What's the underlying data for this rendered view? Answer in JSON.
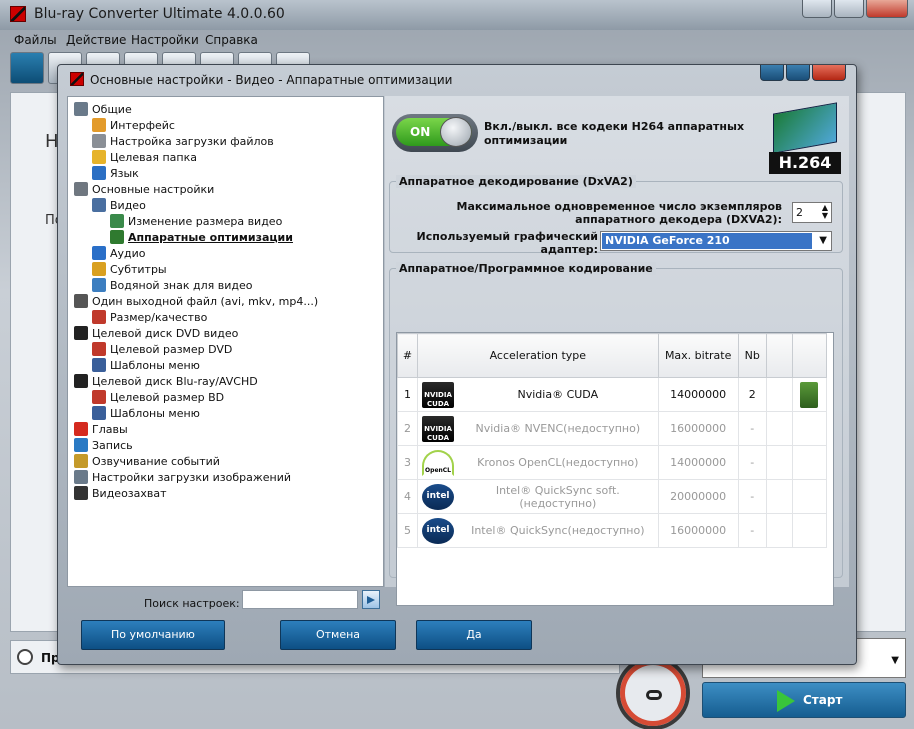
{
  "main_window": {
    "title": "Blu-ray Converter Ultimate 4.0.0.60",
    "menu": [
      "Файлы",
      "Действие",
      "Настройки",
      "Справка"
    ],
    "panel_label_1": "Н",
    "panel_label_2": "По",
    "bottom_left_text": "Пр",
    "profile_value": ")",
    "start_label": "Старт"
  },
  "dialog": {
    "title": "Основные настройки - Видео - Аппаратные оптимизации",
    "tree": [
      {
        "label": "Общие",
        "level": 0,
        "icon": "tools-icon",
        "color": "#6a7a8a"
      },
      {
        "label": "Интерфейс",
        "level": 1,
        "icon": "palette-icon",
        "color": "#e39b2b"
      },
      {
        "label": "Настройка загрузки файлов",
        "level": 1,
        "icon": "document-icon",
        "color": "#8a8f96"
      },
      {
        "label": "Целевая папка",
        "level": 1,
        "icon": "folder-icon",
        "color": "#e6b32a"
      },
      {
        "label": "Язык",
        "level": 1,
        "icon": "globe-icon",
        "color": "#2b6fc4"
      },
      {
        "label": "Основные настройки",
        "level": 0,
        "icon": "gear-icon",
        "color": "#6f7780"
      },
      {
        "label": "Видео",
        "level": 1,
        "icon": "video-icon",
        "color": "#4a6fa0"
      },
      {
        "label": "Изменение размера видео",
        "level": 2,
        "icon": "resize-icon",
        "color": "#3a8a4a"
      },
      {
        "label": "Аппаратные оптимизации",
        "level": 2,
        "icon": "gpu-icon",
        "color": "#2f7a2f",
        "selected": true
      },
      {
        "label": "Аудио",
        "level": 1,
        "icon": "music-note-icon",
        "color": "#2a6fc8"
      },
      {
        "label": "Субтитры",
        "level": 1,
        "icon": "subtitle-icon",
        "color": "#d9a020"
      },
      {
        "label": "Водяной знак для видео",
        "level": 1,
        "icon": "image-icon",
        "color": "#3c7ec0"
      },
      {
        "label": "Один выходной файл (avi, mkv, mp4...)",
        "level": 0,
        "icon": "merge-icon",
        "color": "#555"
      },
      {
        "label": "Размер/качество",
        "level": 1,
        "icon": "quality-icon",
        "color": "#c0392b"
      },
      {
        "label": "Целевой диск DVD видео",
        "level": 0,
        "icon": "dvd-icon",
        "color": "#222"
      },
      {
        "label": "Целевой размер DVD",
        "level": 1,
        "icon": "disc-size-icon",
        "color": "#c0392b"
      },
      {
        "label": "Шаблоны меню",
        "level": 1,
        "icon": "menu-template-icon",
        "color": "#3a5f9a"
      },
      {
        "label": "Целевой диск Blu-ray/AVCHD",
        "level": 0,
        "icon": "hd-icon",
        "color": "#222"
      },
      {
        "label": "Целевой размер BD",
        "level": 1,
        "icon": "disc-size-icon",
        "color": "#c0392b"
      },
      {
        "label": "Шаблоны меню",
        "level": 1,
        "icon": "menu-template-icon",
        "color": "#3a5f9a"
      },
      {
        "label": "Главы",
        "level": 0,
        "icon": "flag-icon",
        "color": "#d42a1f"
      },
      {
        "label": "Запись",
        "level": 0,
        "icon": "burn-disc-icon",
        "color": "#2a7ac4"
      },
      {
        "label": "Озвучивание событий",
        "level": 0,
        "icon": "sound-icon",
        "color": "#c49a2a"
      },
      {
        "label": "Настройки загрузки изображений",
        "level": 0,
        "icon": "image-settings-icon",
        "color": "#6a7a8a"
      },
      {
        "label": "Видеозахват",
        "level": 0,
        "icon": "camera-icon",
        "color": "#333"
      }
    ],
    "search_label": "Поиск настроек:",
    "search_value": "",
    "buttons": {
      "default": "По умолчанию",
      "cancel": "Отмена",
      "ok": "Да"
    },
    "toggle_label": "ON",
    "toggle_state": "on",
    "h264_text": "Вкл./выкл. все кодеки H264 аппаратных оптимизации",
    "h264_logo": "H.264",
    "decode_group": "Аппаратное декодирование (DxVA2)",
    "max_instances_label": "Максимальное одновременное число экземпляров аппаратного декодера (DXVA2):",
    "max_instances_value": "2",
    "adapter_label": "Используемый графический адаптер:",
    "adapter_value": "NVIDIA GeForce 210",
    "encode_group": "Аппаратное/Программное кодирование",
    "table": {
      "headers": [
        "#",
        "Acceleration type",
        "Max. bitrate",
        "Nb",
        "",
        ""
      ],
      "rows": [
        {
          "num": "1",
          "badge": "nvidia-cuda-logo",
          "badge_text": "NVIDIA CUDA",
          "type": "Nvidia® CUDA",
          "bitrate": "14000000",
          "nb": "2",
          "enabled": true
        },
        {
          "num": "2",
          "badge": "nvidia-cuda-logo",
          "badge_text": "NVIDIA CUDA",
          "type": "Nvidia® NVENC(недоступно)",
          "bitrate": "16000000",
          "nb": "-",
          "enabled": false
        },
        {
          "num": "3",
          "badge": "opencl-logo",
          "badge_text": "OpenCL",
          "type": "Kronos OpenCL(недоступно)",
          "bitrate": "14000000",
          "nb": "-",
          "enabled": false
        },
        {
          "num": "4",
          "badge": "intel-logo",
          "badge_text": "intel",
          "type": "Intel® QuickSync soft.(недоступно)",
          "bitrate": "20000000",
          "nb": "-",
          "enabled": false
        },
        {
          "num": "5",
          "badge": "intel-logo",
          "badge_text": "intel",
          "type": "Intel® QuickSync(недоступно)",
          "bitrate": "16000000",
          "nb": "-",
          "enabled": false
        }
      ]
    }
  }
}
